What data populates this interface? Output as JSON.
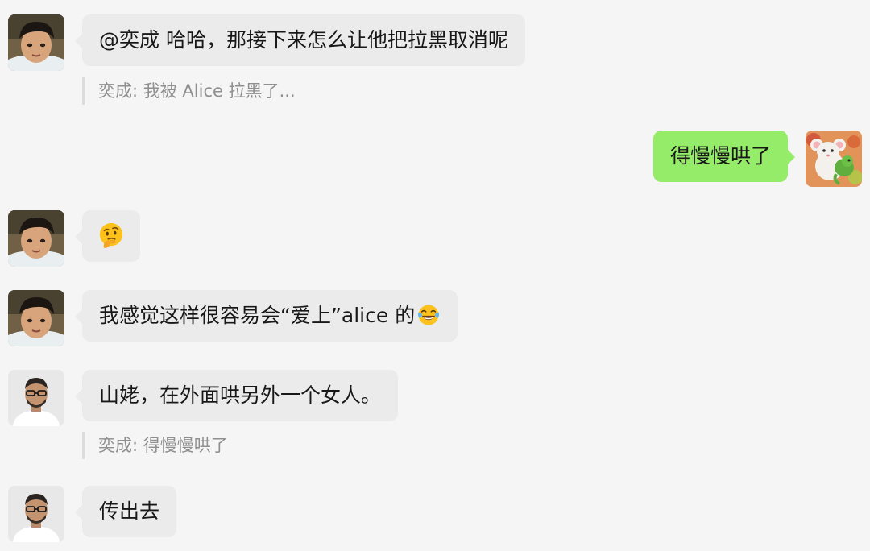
{
  "messages": [
    {
      "sender": "boy",
      "text": "@奕成 哈哈，那接下来怎么让他把拉黑取消呢",
      "quote": "奕成: 我被 Alice 拉黑了..."
    },
    {
      "sender": "me",
      "text": "得慢慢哄了"
    },
    {
      "sender": "boy",
      "emoji": "thinking-face-emoji"
    },
    {
      "sender": "boy",
      "text": "我感觉这样很容易会“爱上”alice 的",
      "emoji": "tears-of-joy-emoji"
    },
    {
      "sender": "man",
      "text": "山姥，在外面哄另外一个女人。",
      "quote": "奕成: 得慢慢哄了"
    },
    {
      "sender": "man",
      "text": "传出去"
    }
  ],
  "colors": {
    "background": "#f5f5f5",
    "incoming_bubble": "#ebebeb",
    "outgoing_bubble": "#95ec69",
    "quote_text": "#8f8f8f"
  }
}
